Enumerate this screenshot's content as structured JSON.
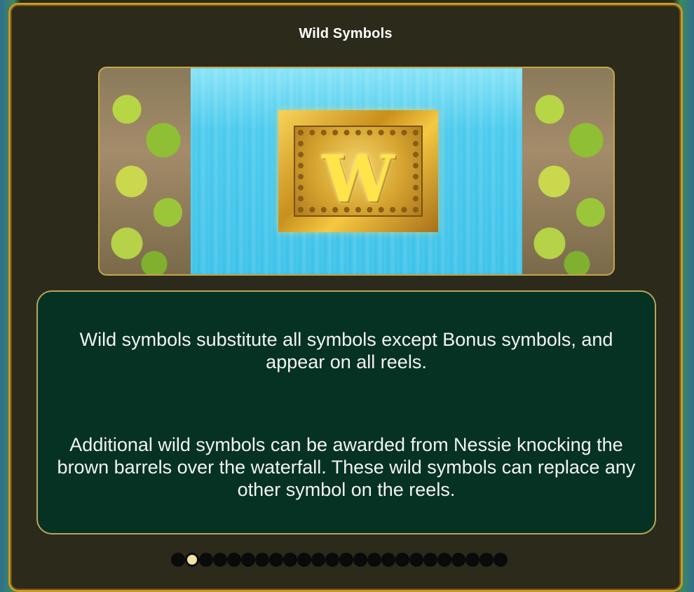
{
  "dialog": {
    "title": "Wild Symbols"
  },
  "symbol": {
    "letter": "W",
    "icon": "wild-symbol-icon"
  },
  "description": {
    "paragraph1": "Wild symbols substitute all symbols except Bonus symbols, and appear on all reels.",
    "paragraph2": "Additional wild symbols can be awarded from Nessie knocking the brown barrels over the waterfall. These wild symbols can replace any other symbol on the reels."
  },
  "pagination": {
    "total": 24,
    "current": 2
  },
  "colors": {
    "panel_bg": "#2b2a1b",
    "panel_border": "#c79a2a",
    "info_bg": "#063223",
    "info_border": "#b8a55c",
    "dot_active": "#f2e3a6"
  }
}
